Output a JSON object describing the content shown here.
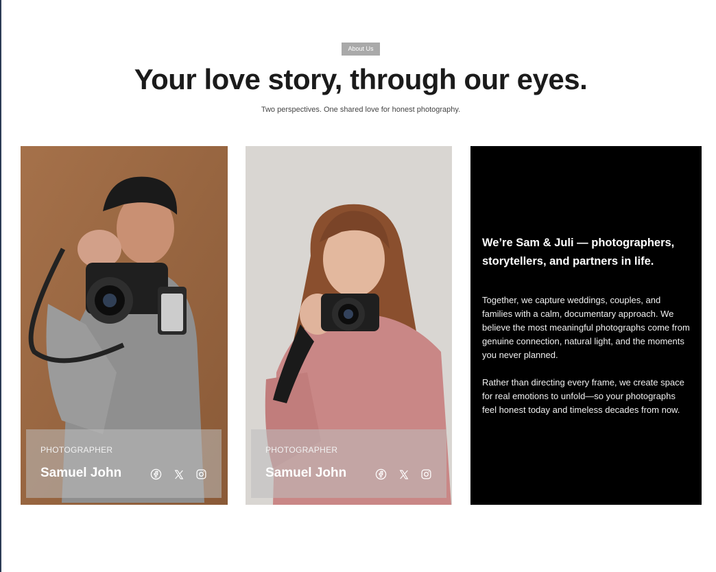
{
  "header": {
    "eyebrow": "About Us",
    "title": "Your love story, through our eyes.",
    "subtitle": "Two perspectives. One shared love for honest photography."
  },
  "team": [
    {
      "role": "PHOTOGRAPHER",
      "name": "Samuel John",
      "socials": [
        "facebook-icon",
        "x-icon",
        "instagram-icon"
      ]
    },
    {
      "role": "PHOTOGRAPHER",
      "name": "Samuel John",
      "socials": [
        "facebook-icon",
        "x-icon",
        "instagram-icon"
      ]
    }
  ],
  "story": {
    "title": "We’re Sam & Juli — photographers, storytellers, and partners in life.",
    "paragraphs": [
      "Together, we capture weddings, couples, and families with a calm, documentary approach. We believe the most meaningful photographs come from genuine connection, natural light, and the moments you never planned.",
      "Rather than directing every frame, we create space for real emotions to unfold—so your photographs feel honest today and timeless decades from now."
    ]
  },
  "colors": {
    "eyebrow_bg": "#a9a9a9",
    "headline": "#1b1b1b",
    "story_bg": "#000000",
    "card1_bg": "#9e6b46",
    "card2_bg": "#d8d5d1"
  }
}
